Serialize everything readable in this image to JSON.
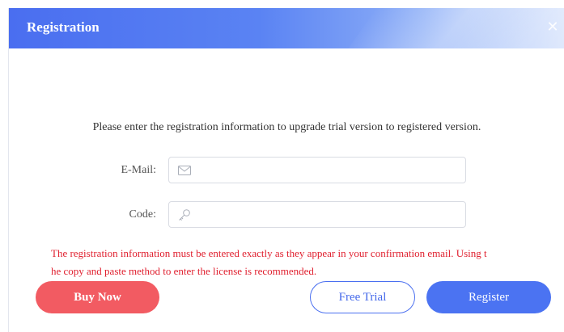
{
  "dialog": {
    "title": "Registration",
    "intro": "Please enter the registration information to upgrade trial version to registered version.",
    "email": {
      "label": "E-Mail:",
      "value": "",
      "icon": "envelope-icon"
    },
    "code": {
      "label": "Code:",
      "value": "",
      "icon": "key-icon"
    },
    "warning_line1": "The registration information must be entered exactly as they appear in your confirmation email. Using t",
    "warning_line2": "he copy and paste method to enter the license is recommended.",
    "buttons": {
      "buy_now": "Buy Now",
      "free_trial": "Free Trial",
      "register": "Register"
    }
  },
  "colors": {
    "title_bar": "#4a6ef0",
    "warning_text": "#e0202f",
    "buy_button": "#f25b62",
    "primary_button": "#4b73f2"
  }
}
